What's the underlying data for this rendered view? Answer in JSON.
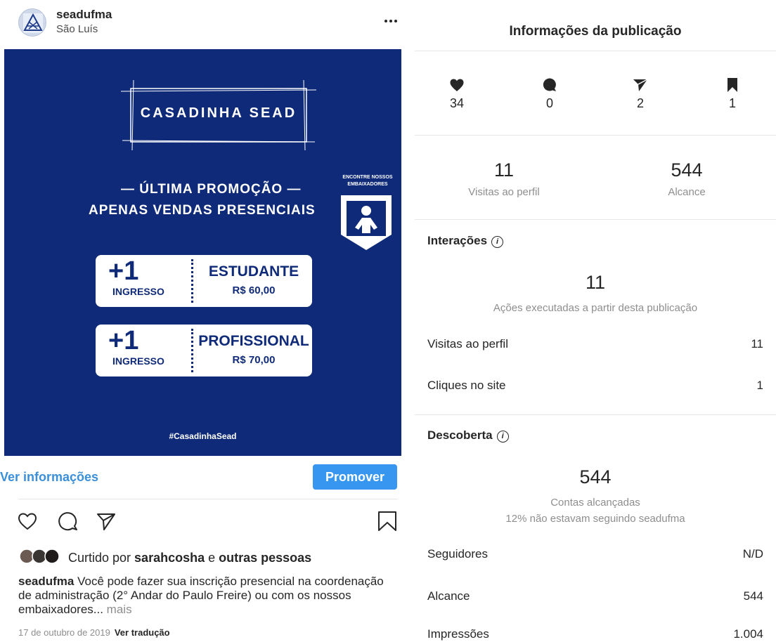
{
  "post": {
    "username": "seadufma",
    "location": "São Luís",
    "image": {
      "title": "CASADINHA SEAD",
      "line1": "— ÚLTIMA PROMOÇÃO —",
      "line2": "APENAS VENDAS PRESENCIAIS",
      "badge_text": "ENCONTRE NOSSOS EMBAIXADORES",
      "tickets": [
        {
          "plus": "+1",
          "ingresso": "INGRESSO",
          "title": "ESTUDANTE",
          "price": "R$ 60,00"
        },
        {
          "plus": "+1",
          "ingresso": "INGRESSO",
          "title": "PROFISSIONAL",
          "price": "R$ 70,00"
        }
      ],
      "hashtag": "#CasadinhaSead"
    },
    "ver_info_label": "Ver informações",
    "promote_label": "Promover",
    "liked_by_prefix": "Curtido por ",
    "liked_by_user": "sarahcosha",
    "liked_by_join": " e ",
    "liked_by_others": "outras pessoas",
    "caption_user": "seadufma",
    "caption_text": " Você pode fazer sua inscrição presencial na coordenação de administração (2° Andar do Paulo Freire) ou com os nossos embaixadores...",
    "caption_more": " mais",
    "date": "17 de outubro de 2019",
    "translate_label": "Ver tradução"
  },
  "insights": {
    "title": "Informações da publicação",
    "stats": {
      "likes": "34",
      "comments": "0",
      "shares": "2",
      "saves": "1"
    },
    "profile_visits": {
      "value": "11",
      "label": "Visitas ao perfil"
    },
    "reach": {
      "value": "544",
      "label": "Alcance"
    },
    "interactions": {
      "title": "Interações",
      "value": "11",
      "label": "Ações executadas a partir desta publicação",
      "rows": [
        {
          "label": "Visitas ao perfil",
          "value": "11"
        },
        {
          "label": "Cliques no site",
          "value": "1"
        }
      ]
    },
    "discovery": {
      "title": "Descoberta",
      "value": "544",
      "label": "Contas alcançadas",
      "sublabel": "12% não estavam seguindo seadufma",
      "rows": [
        {
          "label": "Seguidores",
          "value": "N/D"
        },
        {
          "label": "Alcance",
          "value": "544"
        },
        {
          "label": "Impressões",
          "value": "1.004"
        }
      ]
    }
  },
  "colors": {
    "post_background": "#0f2a78",
    "promote_button": "#3797f0",
    "link_blue": "#3a8fd8"
  },
  "icons": [
    "more-icon",
    "heart-icon",
    "comment-icon",
    "share-icon",
    "save-icon",
    "info-icon",
    "person-icon"
  ]
}
